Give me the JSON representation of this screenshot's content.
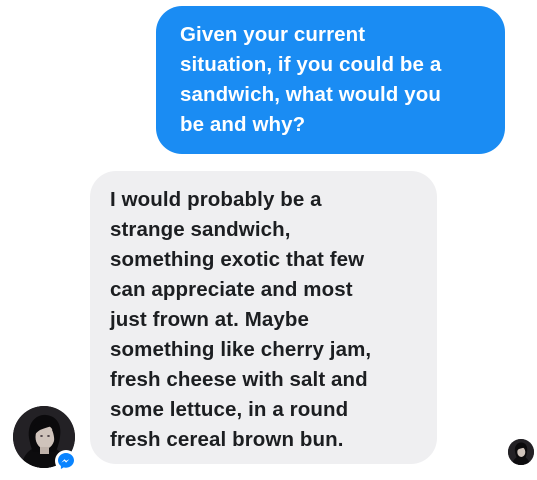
{
  "conversation": {
    "sent_message": {
      "lines": [
        "Given your current",
        "situation, if you could be a",
        "sandwich, what would you",
        "be and why?"
      ]
    },
    "received_message": {
      "lines": [
        "I would probably be a",
        "strange sandwich,",
        "something exotic that few",
        "can appreciate and most",
        "just frown at. Maybe",
        "something like cherry jam,",
        "fresh cheese with salt and",
        "some lettuce, in a round",
        "fresh cereal brown bun."
      ]
    }
  },
  "icons": {
    "contact_avatar": "contact-avatar",
    "messenger_badge": "messenger-icon",
    "read_receipt": "seen-avatar-icon"
  },
  "colors": {
    "sent_bubble": "#1a8cf3",
    "received_bubble": "#efeff1",
    "received_text": "#1c1e21",
    "messenger_blue": "#0a84ff"
  }
}
